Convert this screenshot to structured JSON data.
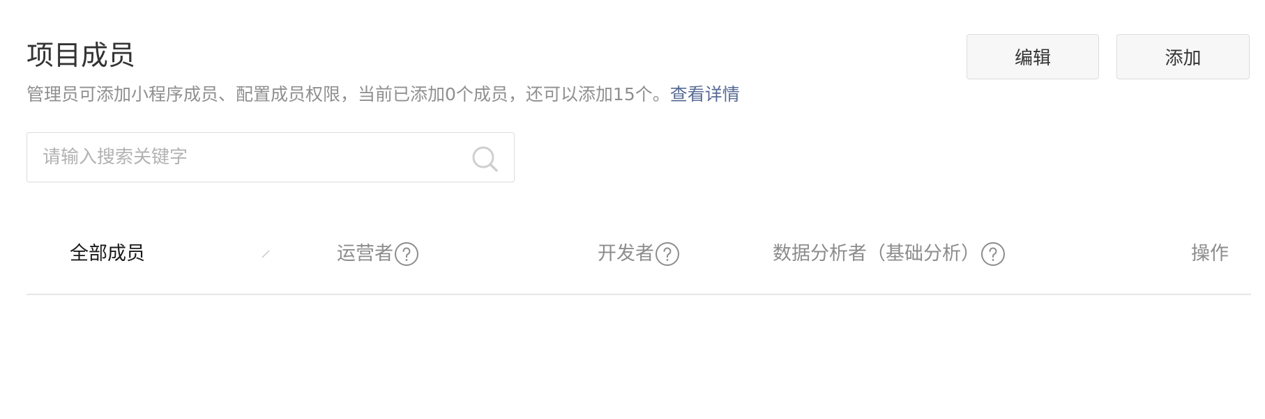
{
  "header": {
    "title": "项目成员",
    "description": "管理员可添加小程序成员、配置成员权限，当前已添加0个成员，还可以添加15个。",
    "detail_link": "查看详情"
  },
  "actions": {
    "edit_label": "编辑",
    "add_label": "添加"
  },
  "search": {
    "placeholder": "请输入搜索关键字",
    "value": "",
    "icon": "search-icon"
  },
  "table": {
    "columns": {
      "all_members": "全部成员",
      "operator": "运营者",
      "developer": "开发者",
      "data_analyst": "数据分析者（基础分析）",
      "action": "操作"
    },
    "help_icon": "question-circle-icon",
    "rows": []
  },
  "colors": {
    "link": "#576b95",
    "muted_text": "#8f8f8f",
    "border": "#dcdcdc"
  }
}
